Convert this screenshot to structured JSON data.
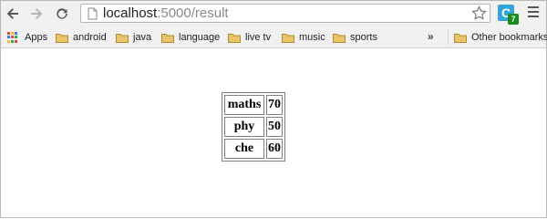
{
  "browser": {
    "url_host": "localhost",
    "url_path": ":5000/result",
    "extension_letter": "C",
    "extension_badge": "7",
    "icons": {
      "back": "back-arrow-icon",
      "forward": "forward-arrow-icon",
      "reload": "reload-icon",
      "page": "page-icon",
      "star": "star-icon",
      "menu": "menu-icon"
    }
  },
  "bookmarks": {
    "apps_label": "Apps",
    "items": [
      {
        "label": "android"
      },
      {
        "label": "java"
      },
      {
        "label": "language"
      },
      {
        "label": "live tv"
      },
      {
        "label": "music"
      },
      {
        "label": "sports"
      }
    ],
    "overflow": "»",
    "other_label": "Other bookmarks"
  },
  "result_table": {
    "rows": [
      {
        "subject": "maths",
        "marks": "70"
      },
      {
        "subject": "phy",
        "marks": "50"
      },
      {
        "subject": "che",
        "marks": "60"
      }
    ]
  },
  "colors": {
    "toolbar_bg": "#f1f1f1",
    "extension_blue": "#33a6d8",
    "badge_green": "#1a8a1a",
    "folder_yellow": "#e9c46a"
  }
}
